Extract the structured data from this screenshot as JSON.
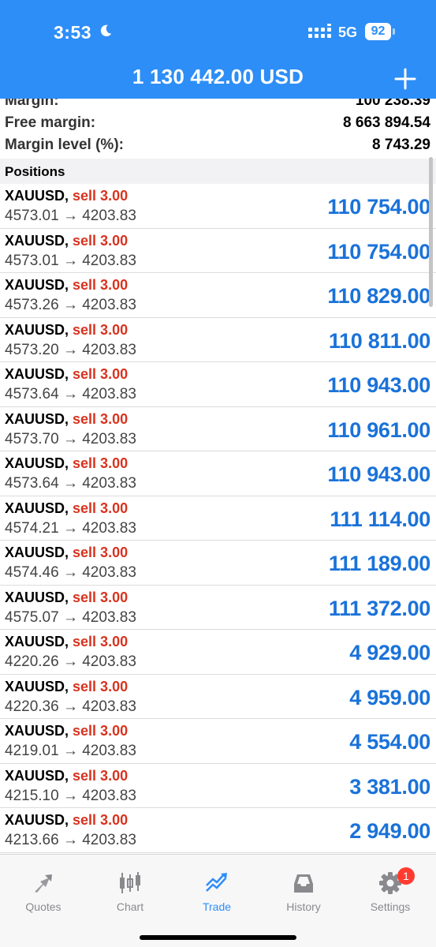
{
  "status_bar": {
    "time": "3:53",
    "network": "5G",
    "battery": "92",
    "icons": [
      "moon-icon",
      "signal-icon",
      "battery-icon"
    ]
  },
  "header": {
    "title": "1 130 442.00 USD",
    "add_icon": "plus-icon"
  },
  "summary": [
    {
      "label": "Margin:",
      "value": "100 238.39"
    },
    {
      "label": "Free margin:",
      "value": "8 663 894.54"
    },
    {
      "label": "Margin level (%):",
      "value": "8 743.29"
    }
  ],
  "positions_header": "Positions",
  "positions": [
    {
      "symbol": "XAUUSD,",
      "side": "sell 3.00",
      "prices": "4573.01 → 4203.83",
      "profit": "110 754.00"
    },
    {
      "symbol": "XAUUSD,",
      "side": "sell 3.00",
      "prices": "4573.01 → 4203.83",
      "profit": "110 754.00"
    },
    {
      "symbol": "XAUUSD,",
      "side": "sell 3.00",
      "prices": "4573.26 → 4203.83",
      "profit": "110 829.00"
    },
    {
      "symbol": "XAUUSD,",
      "side": "sell 3.00",
      "prices": "4573.20 → 4203.83",
      "profit": "110 811.00"
    },
    {
      "symbol": "XAUUSD,",
      "side": "sell 3.00",
      "prices": "4573.64 → 4203.83",
      "profit": "110 943.00"
    },
    {
      "symbol": "XAUUSD,",
      "side": "sell 3.00",
      "prices": "4573.70 → 4203.83",
      "profit": "110 961.00"
    },
    {
      "symbol": "XAUUSD,",
      "side": "sell 3.00",
      "prices": "4573.64 → 4203.83",
      "profit": "110 943.00"
    },
    {
      "symbol": "XAUUSD,",
      "side": "sell 3.00",
      "prices": "4574.21 → 4203.83",
      "profit": "111 114.00"
    },
    {
      "symbol": "XAUUSD,",
      "side": "sell 3.00",
      "prices": "4574.46 → 4203.83",
      "profit": "111 189.00"
    },
    {
      "symbol": "XAUUSD,",
      "side": "sell 3.00",
      "prices": "4575.07 → 4203.83",
      "profit": "111 372.00"
    },
    {
      "symbol": "XAUUSD,",
      "side": "sell 3.00",
      "prices": "4220.26 → 4203.83",
      "profit": "4 929.00"
    },
    {
      "symbol": "XAUUSD,",
      "side": "sell 3.00",
      "prices": "4220.36 → 4203.83",
      "profit": "4 959.00"
    },
    {
      "symbol": "XAUUSD,",
      "side": "sell 3.00",
      "prices": "4219.01 → 4203.83",
      "profit": "4 554.00"
    },
    {
      "symbol": "XAUUSD,",
      "side": "sell 3.00",
      "prices": "4215.10 → 4203.83",
      "profit": "3 381.00"
    },
    {
      "symbol": "XAUUSD,",
      "side": "sell 3.00",
      "prices": "4213.66 → 4203.83",
      "profit": "2 949.00"
    }
  ],
  "tabs": [
    {
      "label": "Quotes",
      "icon": "quotes-arrow-icon"
    },
    {
      "label": "Chart",
      "icon": "candlestick-icon"
    },
    {
      "label": "Trade",
      "icon": "trade-trend-icon"
    },
    {
      "label": "History",
      "icon": "inbox-tray-icon"
    },
    {
      "label": "Settings",
      "icon": "gear-icon",
      "badge": "1"
    }
  ],
  "colors": {
    "header_bg": "#2d8ef7",
    "profit": "#1a72d9",
    "sell": "#d8331f",
    "tab_active": "#2d8ef7",
    "tab_inactive": "#8a8a8e",
    "badge": "#ff3b30"
  }
}
